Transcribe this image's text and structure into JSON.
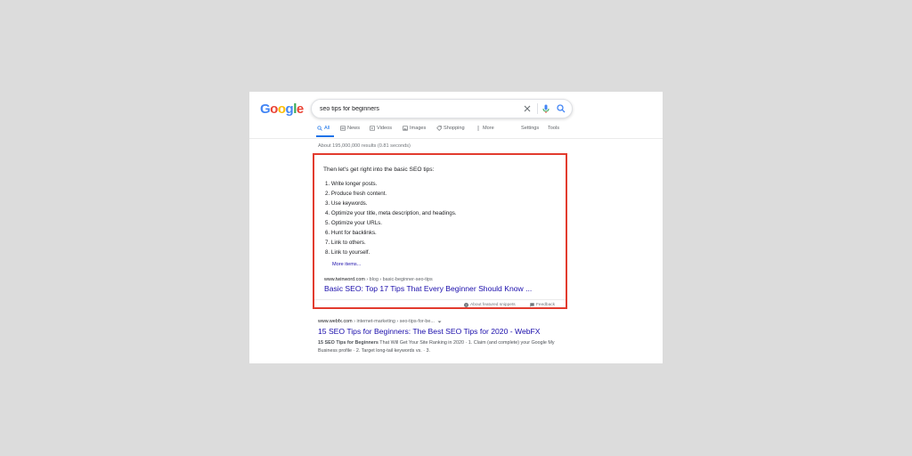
{
  "logo": {
    "letters": [
      "G",
      "o",
      "o",
      "g",
      "l",
      "e"
    ],
    "colors": [
      "#4285f4",
      "#ea4335",
      "#fbbc05",
      "#4285f4",
      "#34a853",
      "#ea4335"
    ]
  },
  "search": {
    "query": "seo tips for beginners",
    "icons": [
      "close-icon",
      "mic-icon",
      "search-icon"
    ]
  },
  "tabs": [
    {
      "label": "All",
      "icon": "search-icon",
      "active": true
    },
    {
      "label": "News",
      "icon": "news-icon"
    },
    {
      "label": "Videos",
      "icon": "video-icon"
    },
    {
      "label": "Images",
      "icon": "image-icon"
    },
    {
      "label": "Shopping",
      "icon": "tag-icon"
    },
    {
      "label": "More",
      "icon": "more-dots-icon"
    }
  ],
  "tools": {
    "settings": "Settings",
    "tools": "Tools"
  },
  "results_count": "About 195,000,000 results (0.81 seconds)",
  "snippet": {
    "heading": "Then let's get right into the basic SEO tips:",
    "items": [
      "1. Write longer posts.",
      "2. Produce fresh content.",
      "3. Use keywords.",
      "4. Optimize your title, meta description, and headings.",
      "5. Optimize your URLs.",
      "6. Hunt for backlinks.",
      "7. Link to others.",
      "8. Link to yourself."
    ],
    "more_items": "More items...",
    "cite_domain": "www.twinword.com",
    "cite_path": " › blog › basic-beginner-seo-tips",
    "title": "Basic SEO: Top 17 Tips That Every Beginner Should Know ...",
    "about": "About featured snippets",
    "feedback": "Feedback",
    "border_color": "#e23b2e"
  },
  "result2": {
    "cite_domain": "www.webfx.com",
    "cite_path": " › internet-marketing › seo-tips-for-be...",
    "title": "15 SEO Tips for Beginners: The Best SEO Tips for 2020 - WebFX",
    "desc_bold": "15 SEO Tips for Beginners",
    "desc_rest": " That Will Get Your Site Ranking in 2020 · 1. Claim (and complete) your Google My Business profile · 2. Target long-tail keywords vs. · 3."
  },
  "colors": {
    "link": "#1a0dab",
    "accent": "#1a73e8"
  }
}
